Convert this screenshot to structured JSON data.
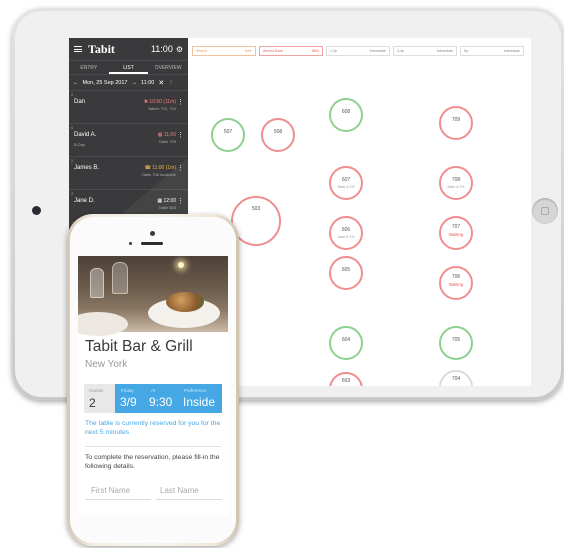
{
  "app": {
    "brand": "Tabit",
    "clock": "11:00",
    "tabs": [
      "ENTRY",
      "LIST",
      "OVERVIEW"
    ],
    "active_tab": "LIST",
    "date": "Mon, 25 Sep 2017",
    "date_time": "11:00"
  },
  "reservations": [
    {
      "num": "2",
      "name": "Dan",
      "sub": "",
      "time": "10:50 (11m)",
      "table": "Tables 702, 704"
    },
    {
      "num": "6",
      "name": "David A.",
      "sub": "B-Day",
      "time": "11:00",
      "table": "Table 705"
    },
    {
      "num": "2",
      "name": "James B.",
      "sub": "",
      "time": "11:00 (1m)",
      "table": "Table 706 Available"
    },
    {
      "num": "4",
      "name": "Jane D.",
      "sub": "",
      "time": "12:00",
      "table": "Table 505"
    }
  ],
  "filters": [
    {
      "label": "Search",
      "value": "84%"
    },
    {
      "label": "Almost Done",
      "value": "86%"
    },
    {
      "label": "1-2p",
      "value": "Immediate"
    },
    {
      "label": "3-4p",
      "value": "Immediate"
    },
    {
      "label": "5p",
      "value": "Immediate"
    }
  ],
  "tables": [
    {
      "id": "507",
      "status": "green",
      "note": ""
    },
    {
      "id": "508",
      "status": "red",
      "note": ""
    },
    {
      "id": "608",
      "status": "green",
      "note": ""
    },
    {
      "id": "709",
      "status": "red",
      "note": ""
    },
    {
      "id": "607",
      "status": "red",
      "note": "Mark & 2%"
    },
    {
      "id": "708",
      "status": "red",
      "note": "Mark & 2%"
    },
    {
      "id": "503",
      "status": "red",
      "note": ""
    },
    {
      "id": "606",
      "status": "red",
      "note": "Jane & 2%"
    },
    {
      "id": "707",
      "status": "red",
      "note": "Waiting"
    },
    {
      "id": "605",
      "status": "red",
      "note": ""
    },
    {
      "id": "706",
      "status": "red",
      "note": "Waiting"
    },
    {
      "id": "604",
      "status": "green",
      "note": ""
    },
    {
      "id": "705",
      "status": "green",
      "note": ""
    },
    {
      "id": "603",
      "status": "red",
      "note": ""
    },
    {
      "id": "704",
      "status": "green",
      "note": ""
    }
  ],
  "phone": {
    "restaurant": "Tabit Bar & Grill",
    "city": "New York",
    "guests_label": "Guests",
    "guests": "2",
    "day_label": "Friday",
    "date": "3/9",
    "time_label": "At",
    "time": "9:30",
    "pref_label": "Preference",
    "preference": "Inside",
    "reserved_note": "The table is currently reserved for you for the next 5 minutes",
    "instructions": "To complete the reservation, please fill-in the following details.",
    "first_name_placeholder": "First Name",
    "last_name_placeholder": "Last Name"
  },
  "colors": {
    "accent_blue": "#45a8e4",
    "status_green": "#8fd08f",
    "status_red": "#ef8e8e",
    "panel_dark": "#3a3a3c"
  }
}
